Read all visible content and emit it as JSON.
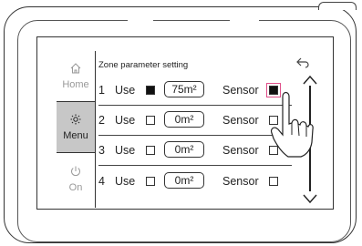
{
  "sidebar": {
    "home_label": "Home",
    "menu_label": "Menu",
    "on_label": "On"
  },
  "panel": {
    "title": "Zone parameter setting"
  },
  "rows": [
    {
      "index": "1",
      "use_label": "Use",
      "use_checked": true,
      "area": "75m²",
      "sensor_label": "Sensor",
      "sensor_checked": true
    },
    {
      "index": "2",
      "use_label": "Use",
      "use_checked": false,
      "area": "0m²",
      "sensor_label": "Sensor",
      "sensor_checked": false
    },
    {
      "index": "3",
      "use_label": "Use",
      "use_checked": false,
      "area": "0m²",
      "sensor_label": "Sensor",
      "sensor_checked": false
    },
    {
      "index": "4",
      "use_label": "Use",
      "use_checked": false,
      "area": "0m²",
      "sensor_label": "Sensor",
      "sensor_checked": false
    }
  ],
  "colors": {
    "active_tab": "#c7c7c7",
    "highlight": "#e0508a"
  }
}
